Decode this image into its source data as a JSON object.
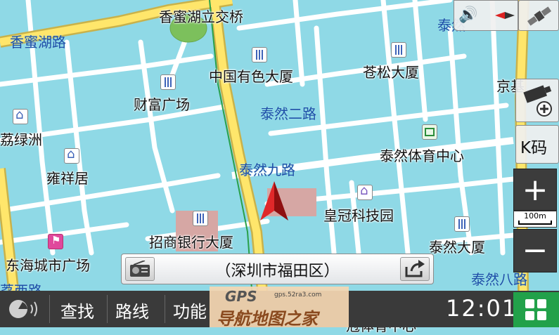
{
  "map": {
    "places": [
      {
        "id": "xiangmi-lake-overpass",
        "text": "香蜜湖立交桥"
      },
      {
        "id": "china-nonferrous",
        "text": "中国有色大厦"
      },
      {
        "id": "cangsong",
        "text": "苍松大厦"
      },
      {
        "id": "caifu",
        "text": "财富广场"
      },
      {
        "id": "lizhou",
        "text": "荔绿洲"
      },
      {
        "id": "yongxiang",
        "text": "雍祥居"
      },
      {
        "id": "taoran-sports",
        "text": "泰然体育中心"
      },
      {
        "id": "huangguan-park",
        "text": "皇冠科技园"
      },
      {
        "id": "cmb-tower",
        "text": "招商银行大厦"
      },
      {
        "id": "taoran-tower",
        "text": "泰然大厦"
      },
      {
        "id": "donghai-mall",
        "text": "东海城市广场"
      },
      {
        "id": "jingji",
        "text": "京基"
      },
      {
        "id": "huangguan-sports",
        "text": "冠体育中心"
      }
    ],
    "roads": [
      {
        "id": "xiangmi-lake-rd",
        "text": "香蜜湖路"
      },
      {
        "id": "taoran-2nd-rd",
        "text": "泰然二路"
      },
      {
        "id": "taoran-9th-rd",
        "text": "泰然九路"
      },
      {
        "id": "taoran-8th-rd",
        "text": "泰然八路"
      },
      {
        "id": "taoran-top",
        "text": "泰然"
      },
      {
        "id": "lixi-rd",
        "text": "荔西路"
      }
    ]
  },
  "controls": {
    "k_code_label": "K码",
    "zoom_in_label": "+",
    "zoom_out_label": "−",
    "scale_label": "100m"
  },
  "address_bar": {
    "text": "（深圳市福田区）"
  },
  "bottom_bar": {
    "menu": [
      "查找",
      "路线",
      "功能"
    ],
    "time": "12:01"
  },
  "watermark": {
    "brand": "GPS",
    "url": "gps.52ra3.com",
    "title": "导航地图之家"
  }
}
